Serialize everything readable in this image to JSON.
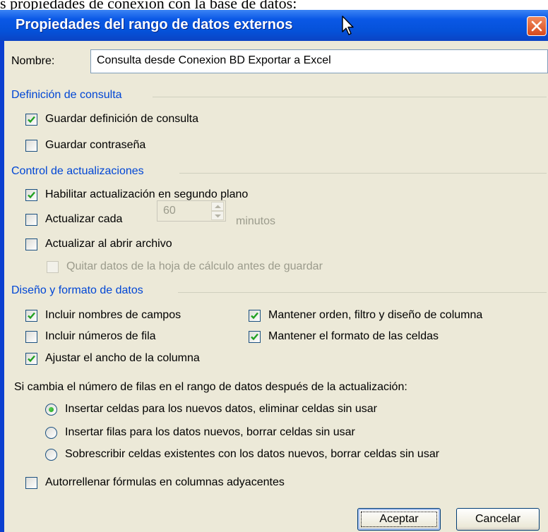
{
  "background_text": "s propiedades de conexión con la base de datos:",
  "dialog": {
    "title": "Propiedades del rango de datos externos",
    "name_label": "Nombre:",
    "name_value": "Consulta desde Conexion BD Exportar a Excel",
    "sections": {
      "query_definition": "Definición de consulta",
      "refresh_control": "Control de actualizaciones",
      "layout_format": "Diseño y formato de datos"
    },
    "query": {
      "save_definition": {
        "label": "Guardar definición de consulta",
        "checked": true
      },
      "save_password": {
        "label": "Guardar contraseña",
        "checked": false
      }
    },
    "refresh": {
      "background": {
        "label": "Habilitar actualización en segundo plano",
        "checked": true
      },
      "every": {
        "label": "Actualizar cada",
        "checked": false,
        "value": "60",
        "unit": "minutos"
      },
      "on_open": {
        "label": "Actualizar al abrir archivo",
        "checked": false
      },
      "remove_data": {
        "label": "Quitar datos de la hoja de cálculo antes de guardar",
        "checked": false,
        "disabled": true
      }
    },
    "layout": {
      "field_names": {
        "label": "Incluir nombres de campos",
        "checked": true
      },
      "row_numbers": {
        "label": "Incluir números de fila",
        "checked": false
      },
      "adjust_width": {
        "label": "Ajustar el ancho de la columna",
        "checked": true
      },
      "preserve_sort": {
        "label": "Mantener orden, filtro y diseño de columna",
        "checked": true
      },
      "preserve_format": {
        "label": "Mantener el formato de las celdas",
        "checked": true
      }
    },
    "rows_change_prompt": "Si cambia el número de filas en el rango de datos después de la actualización:",
    "radio_options": [
      {
        "label": "Insertar celdas para los nuevos datos, eliminar celdas sin usar",
        "selected": true
      },
      {
        "label": "Insertar filas para los datos nuevos, borrar celdas sin usar",
        "selected": false
      },
      {
        "label": "Sobrescribir celdas existentes con los datos nuevos, borrar celdas sin usar",
        "selected": false
      }
    ],
    "fill_down": {
      "label": "Autorrellenar fórmulas en columnas adyacentes",
      "checked": false
    },
    "ok_label": "Aceptar",
    "cancel_label": "Cancelar"
  },
  "colors": {
    "title_bar": "#0a58e6",
    "section_heading": "#0046d5",
    "dialog_background": "#ece9d8",
    "check_mark": "#21a121",
    "close_button": "#d84a1c"
  },
  "icons": [
    "close-icon",
    "mouse-pointer-icon",
    "check-icon",
    "spinner-up-icon",
    "spinner-down-icon"
  ]
}
